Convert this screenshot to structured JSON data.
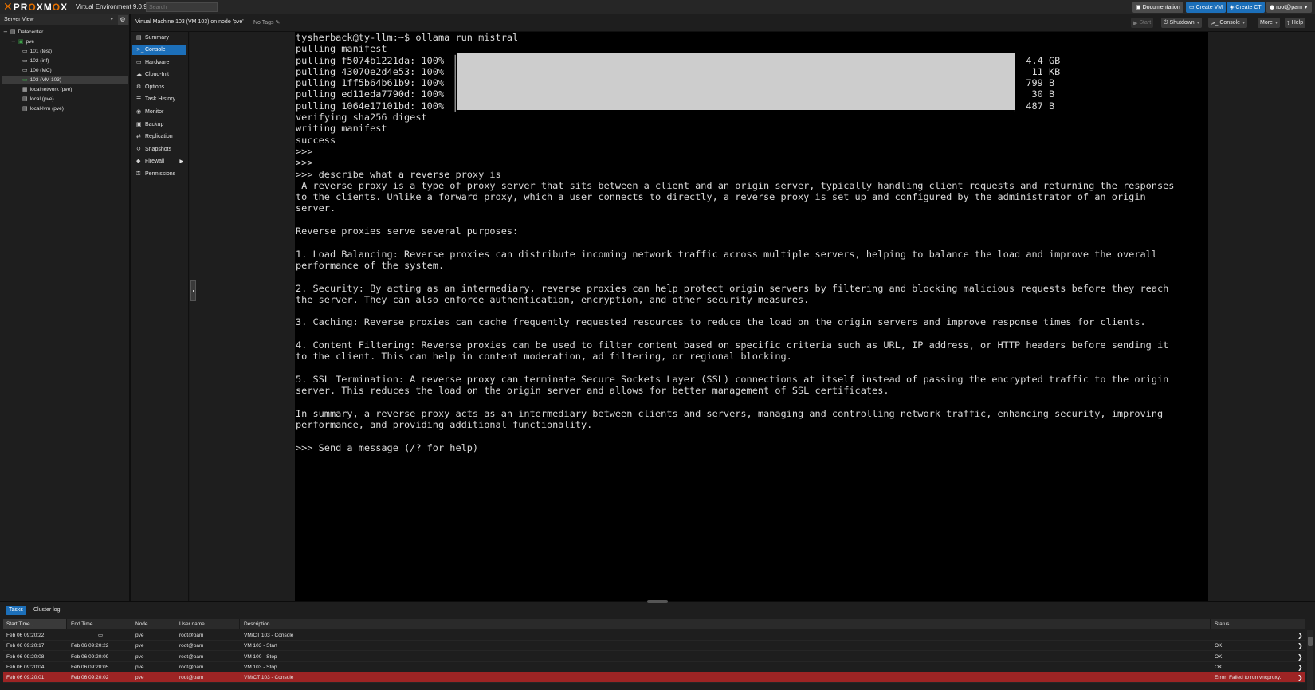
{
  "header": {
    "logo_text_pre": "PR",
    "logo_text_o": "O",
    "logo_text_mid": "XM",
    "logo_text_o2": "O",
    "logo_text_post": "X",
    "version": "Virtual Environment 9.0.9",
    "search_placeholder": "Search",
    "documentation": "Documentation",
    "create_vm": "Create VM",
    "create_ct": "Create CT",
    "user": "root@pam"
  },
  "tree": {
    "view": "Server View",
    "datacenter": "Datacenter",
    "node": "pve",
    "items": [
      "101 (test)",
      "102 (inf)",
      "100 (MC)",
      "103 (VM 103)",
      "localnetwork (pve)",
      "local (pve)",
      "local-lvm (pve)"
    ]
  },
  "vm": {
    "title": "Virtual Machine 103 (VM 103) on node 'pve'",
    "tags": "No Tags",
    "start": "Start",
    "shutdown": "Shutdown",
    "console": "Console",
    "more": "More",
    "help": "Help"
  },
  "submenu": [
    "Summary",
    "Console",
    "Hardware",
    "Cloud-Init",
    "Options",
    "Task History",
    "Monitor",
    "Backup",
    "Replication",
    "Snapshots",
    "Firewall",
    "Permissions"
  ],
  "terminal": {
    "lines": [
      "tysherback@ty-llm:~$ ollama run mistral",
      "pulling manifest",
      "pulling f5074b1221da: 100% ▕                                                                                                  ▏ 4.4 GB",
      "pulling 43070e2d4e53: 100% ▕                                                                                                  ▏  11 KB",
      "pulling 1ff5b64b61b9: 100% ▕                                                                                                  ▏ 799 B",
      "pulling ed11eda7790d: 100% ▕                                                                                                  ▏  30 B",
      "pulling 1064e17101bd: 100% ▕                                                                                                  ▏ 487 B",
      "verifying sha256 digest",
      "writing manifest",
      "success",
      ">>>",
      ">>>",
      ">>> describe what a reverse proxy is",
      " A reverse proxy is a type of proxy server that sits between a client and an origin server, typically handling client requests and returning the responses",
      "to the clients. Unlike a forward proxy, which a user connects to directly, a reverse proxy is set up and configured by the administrator of an origin",
      "server.",
      "",
      "Reverse proxies serve several purposes:",
      "",
      "1. Load Balancing: Reverse proxies can distribute incoming network traffic across multiple servers, helping to balance the load and improve the overall",
      "performance of the system.",
      "",
      "2. Security: By acting as an intermediary, reverse proxies can help protect origin servers by filtering and blocking malicious requests before they reach",
      "the server. They can also enforce authentication, encryption, and other security measures.",
      "",
      "3. Caching: Reverse proxies can cache frequently requested resources to reduce the load on the origin servers and improve response times for clients.",
      "",
      "4. Content Filtering: Reverse proxies can be used to filter content based on specific criteria such as URL, IP address, or HTTP headers before sending it",
      "to the client. This can help in content moderation, ad filtering, or regional blocking.",
      "",
      "5. SSL Termination: A reverse proxy can terminate Secure Sockets Layer (SSL) connections at itself instead of passing the encrypted traffic to the origin",
      "server. This reduces the load on the origin server and allows for better management of SSL certificates.",
      "",
      "In summary, a reverse proxy acts as an intermediary between clients and servers, managing and controlling network traffic, enhancing security, improving",
      "performance, and providing additional functionality.",
      "",
      ">>> Send a message (/? for help)"
    ]
  },
  "tasks": {
    "tabs": [
      "Tasks",
      "Cluster log"
    ],
    "columns": [
      "Start Time",
      "End Time",
      "Node",
      "User name",
      "Description",
      "Status"
    ],
    "sort_indicator": "↓",
    "rows": [
      {
        "start": "Feb 06 09:20:22",
        "end": "",
        "node": "pve",
        "user": "root@pam",
        "desc": "VM/CT 103 - Console",
        "status": "",
        "running": true,
        "error": false
      },
      {
        "start": "Feb 06 09:20:17",
        "end": "Feb 06 09:20:22",
        "node": "pve",
        "user": "root@pam",
        "desc": "VM 103 - Start",
        "status": "OK",
        "running": false,
        "error": false
      },
      {
        "start": "Feb 06 09:20:08",
        "end": "Feb 06 09:20:09",
        "node": "pve",
        "user": "root@pam",
        "desc": "VM 100 - Stop",
        "status": "OK",
        "running": false,
        "error": false
      },
      {
        "start": "Feb 06 09:20:04",
        "end": "Feb 06 09:20:05",
        "node": "pve",
        "user": "root@pam",
        "desc": "VM 103 - Stop",
        "status": "OK",
        "running": false,
        "error": false
      },
      {
        "start": "Feb 06 09:20:01",
        "end": "Feb 06 09:20:02",
        "node": "pve",
        "user": "root@pam",
        "desc": "VM/CT 103 - Console",
        "status": "Error: Failed to run vncproxy.",
        "running": false,
        "error": true
      }
    ]
  },
  "colors": {
    "accent": "#1c6fb9",
    "logo_orange": "#e57000",
    "error_row": "#9d2424"
  }
}
